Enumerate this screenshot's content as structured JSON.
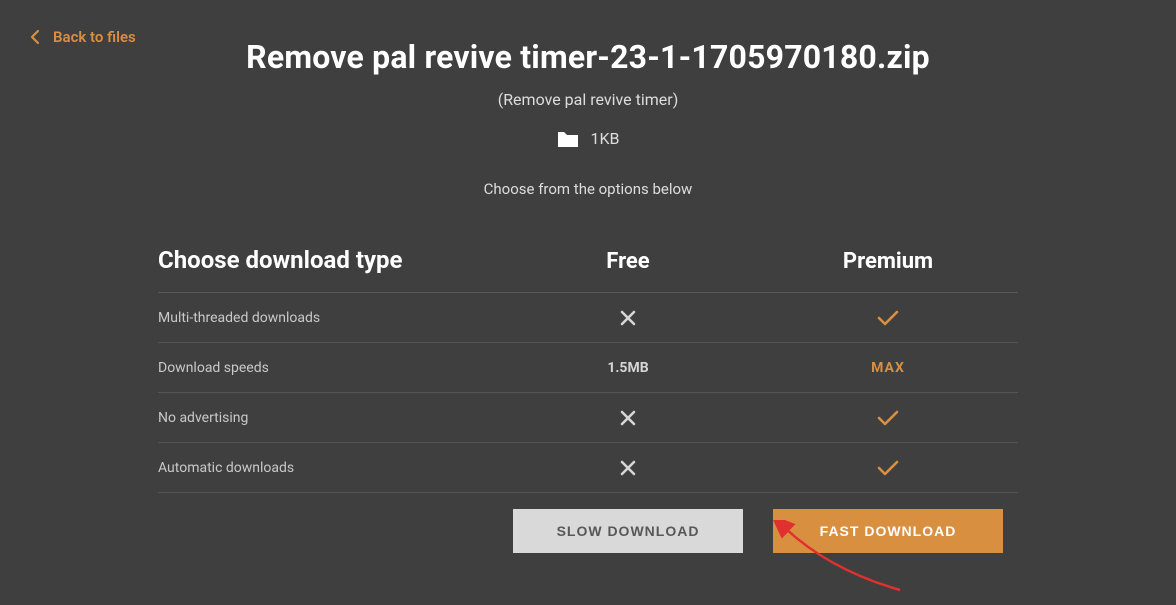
{
  "back_link": "Back to files",
  "file": {
    "title": "Remove pal revive timer-23-1-1705970180.zip",
    "subtitle": "(Remove pal revive timer)",
    "size": "1KB"
  },
  "choose_prompt": "Choose from the options below",
  "table": {
    "head_label": "Choose download type",
    "col_free": "Free",
    "col_premium": "Premium",
    "rows": [
      {
        "label": "Multi-threaded downloads",
        "free_type": "x",
        "prem_type": "check"
      },
      {
        "label": "Download speeds",
        "free_type": "text",
        "free_text": "1.5MB",
        "prem_type": "text",
        "prem_text": "MAX"
      },
      {
        "label": "No advertising",
        "free_type": "x",
        "prem_type": "check"
      },
      {
        "label": "Automatic downloads",
        "free_type": "x",
        "prem_type": "check"
      }
    ]
  },
  "buttons": {
    "slow": "SLOW DOWNLOAD",
    "fast": "FAST DOWNLOAD"
  }
}
